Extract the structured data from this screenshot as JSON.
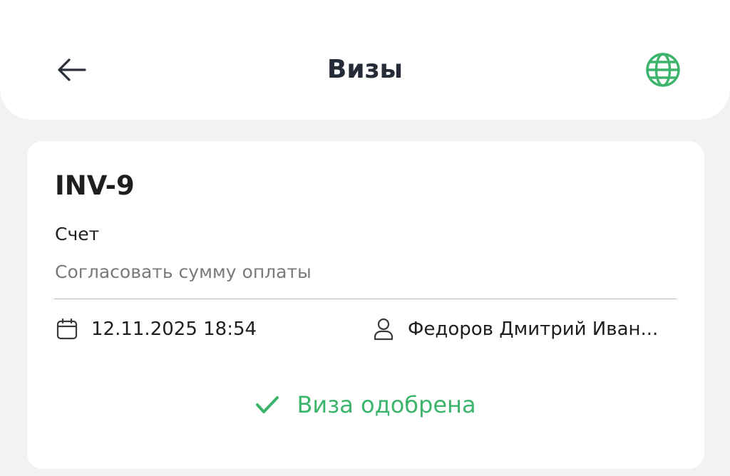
{
  "header": {
    "title": "Визы",
    "back_icon": "arrow-left-icon",
    "language_icon": "globe-icon"
  },
  "card": {
    "number": "INV-9",
    "type": "Счет",
    "description": "Согласовать сумму оплаты",
    "date_icon": "calendar-icon",
    "date": "12.11.2025 18:54",
    "person_icon": "user-icon",
    "person": "Федоров Дмитрий Иван...",
    "status_icon": "check-icon",
    "status": "Виза одобрена"
  },
  "colors": {
    "accent_green": "#3cb46b",
    "background": "#f2f2f2",
    "card": "#ffffff"
  }
}
